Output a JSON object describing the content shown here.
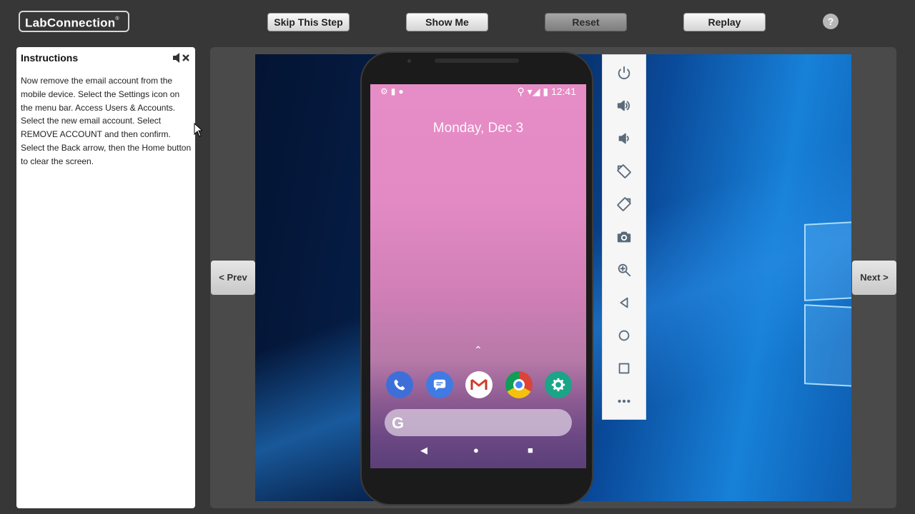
{
  "header": {
    "logo": "LabConnection",
    "logo_reg": "®",
    "buttons": {
      "skip": "Skip This Step",
      "show": "Show Me",
      "reset": "Reset",
      "replay": "Replay"
    },
    "help": "?"
  },
  "instructions": {
    "title": "Instructions",
    "text": "Now remove the email account from the mobile device. Select the Settings icon on the menu bar. Access Users & Accounts. Select the new email account. Select REMOVE ACCOUNT and then confirm. Select the Back arrow, then the Home button to clear the screen."
  },
  "nav": {
    "prev": "< Prev",
    "next": "Next >"
  },
  "phone": {
    "time": "12:41",
    "date": "Monday, Dec 3",
    "dock_apps": [
      "phone-icon",
      "messages-icon",
      "gmail-icon",
      "chrome-icon",
      "settings-icon"
    ],
    "search_glyph": "G"
  },
  "emulator_toolbar": [
    "power-icon",
    "volume-up-icon",
    "volume-down-icon",
    "rotate-left-icon",
    "rotate-right-icon",
    "camera-icon",
    "zoom-icon",
    "back-icon",
    "home-icon",
    "overview-icon",
    "more-icon"
  ]
}
